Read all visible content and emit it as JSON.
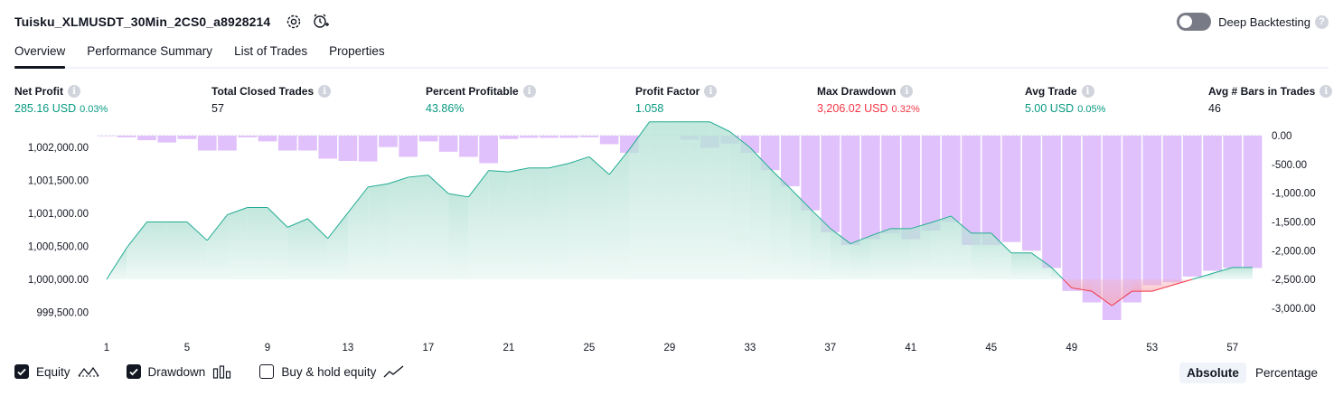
{
  "header": {
    "strategy_name": "Tuisku_XLMUSDT_30Min_2CS0_a8928214",
    "icons": [
      "settings-icon",
      "add-alert-icon"
    ],
    "deep_backtesting_label": "Deep Backtesting",
    "deep_backtesting_enabled": false
  },
  "tabs": [
    {
      "label": "Overview",
      "active": true
    },
    {
      "label": "Performance Summary",
      "active": false
    },
    {
      "label": "List of Trades",
      "active": false
    },
    {
      "label": "Properties",
      "active": false
    }
  ],
  "metrics": {
    "net_profit": {
      "label": "Net Profit",
      "value": "285.16 USD",
      "pct": "0.03%"
    },
    "total_closed_trades": {
      "label": "Total Closed Trades",
      "value": "57"
    },
    "percent_profitable": {
      "label": "Percent Profitable",
      "value": "43.86%"
    },
    "profit_factor": {
      "label": "Profit Factor",
      "value": "1.058"
    },
    "max_drawdown": {
      "label": "Max Drawdown",
      "value": "3,206.02 USD",
      "pct": "0.32%"
    },
    "avg_trade": {
      "label": "Avg Trade",
      "value": "5.00 USD",
      "pct": "0.05%"
    },
    "avg_bars": {
      "label": "Avg # Bars in Trades",
      "value": "46"
    }
  },
  "colors": {
    "positive": "#089981",
    "negative": "#f23645",
    "drawdown_bar": "#e1c1fc",
    "equity_line": "#22ab94",
    "equity_fill": "#b8e3d7",
    "underwater_line": "#f23645"
  },
  "chart_data": {
    "type": "line",
    "title": "",
    "x": [
      1,
      2,
      3,
      4,
      5,
      6,
      7,
      8,
      9,
      10,
      11,
      12,
      13,
      14,
      15,
      16,
      17,
      18,
      19,
      20,
      21,
      22,
      23,
      24,
      25,
      26,
      27,
      28,
      29,
      30,
      31,
      32,
      33,
      34,
      35,
      36,
      37,
      38,
      39,
      40,
      41,
      42,
      43,
      44,
      45,
      46,
      47,
      48,
      49,
      50,
      51,
      52,
      53,
      54,
      55,
      56,
      57,
      58
    ],
    "x_ticks": [
      "1",
      "5",
      "9",
      "13",
      "17",
      "21",
      "25",
      "29",
      "33",
      "37",
      "41",
      "45",
      "49",
      "53",
      "57"
    ],
    "series": [
      {
        "name": "Equity",
        "axis": "left",
        "baseline": 1000000,
        "values": [
          1000000,
          1000480,
          1000870,
          1000870,
          1000870,
          1000590,
          1000980,
          1001090,
          1001090,
          1000790,
          1000920,
          1000620,
          1001010,
          1001400,
          1001450,
          1001550,
          1001580,
          1001300,
          1001250,
          1001650,
          1001630,
          1001690,
          1001690,
          1001760,
          1001860,
          1001590,
          1001970,
          1002390,
          1002390,
          1002390,
          1002390,
          1002240,
          1002000,
          1001680,
          1001380,
          1001070,
          1000770,
          1000540,
          1000660,
          1000770,
          1000770,
          1000860,
          1000960,
          1000700,
          1000700,
          1000400,
          1000400,
          1000180,
          999870,
          999820,
          999600,
          999820,
          999820,
          999910,
          1000000,
          1000090,
          1000180,
          1000180
        ]
      },
      {
        "name": "Drawdown",
        "axis": "right",
        "values": [
          -10,
          -30,
          -80,
          -120,
          -60,
          -260,
          -260,
          -30,
          -100,
          -260,
          -260,
          -400,
          -440,
          -450,
          -200,
          -370,
          -100,
          -280,
          -370,
          -480,
          -60,
          -40,
          -40,
          -40,
          -30,
          -150,
          -300,
          0,
          0,
          -70,
          -210,
          -140,
          -300,
          -600,
          -880,
          -1300,
          -1680,
          -1900,
          -1800,
          -1700,
          -1800,
          -1650,
          -1500,
          -1900,
          -1900,
          -1850,
          -2000,
          -2300,
          -2700,
          -2900,
          -3206,
          -2900,
          -2600,
          -2550,
          -2450,
          -2350,
          -2300,
          -2300
        ]
      }
    ],
    "y_left": {
      "range": [
        999300,
        1002180
      ],
      "ticks": [
        "999,500.00",
        "1,000,000.00",
        "1,000,500.00",
        "1,001,000.00",
        "1,001,500.00",
        "1,002,000.00"
      ]
    },
    "y_right": {
      "range": [
        -3300,
        0
      ],
      "ticks": [
        "0.00",
        "-500.00",
        "-1,000.00",
        "-1,500.00",
        "-2,000.00",
        "-2,500.00",
        "-3,000.00"
      ]
    },
    "grid": false
  },
  "legend": {
    "items": [
      {
        "label": "Equity",
        "checked": true,
        "icon": "equity-line-icon"
      },
      {
        "label": "Drawdown",
        "checked": true,
        "icon": "drawdown-bars-icon"
      },
      {
        "label": "Buy & hold equity",
        "checked": false,
        "icon": "buy-hold-line-icon"
      }
    ]
  },
  "view_mode": {
    "options": [
      "Absolute",
      "Percentage"
    ],
    "selected": "Absolute"
  }
}
